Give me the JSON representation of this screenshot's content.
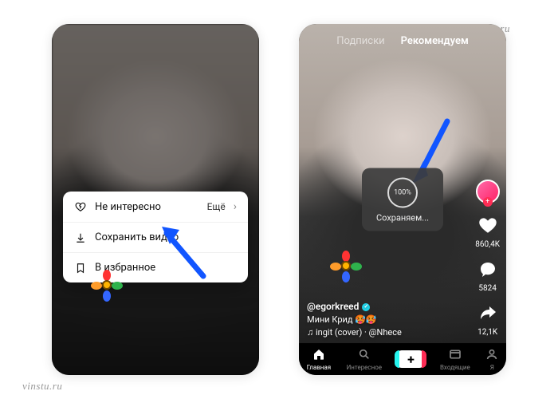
{
  "watermark": "vinstu.ru",
  "left": {
    "sheet": {
      "row1_label": "Не интересно",
      "row1_more": "Ещё",
      "row2_label": "Сохранить видео",
      "row3_label": "В избранное"
    }
  },
  "right": {
    "tabs": {
      "following": "Подписки",
      "foryou": "Рекомендуем"
    },
    "toast": {
      "percent": "100%",
      "label": "Сохраняем..."
    },
    "rail": {
      "likes": "860,4K",
      "comments": "5824",
      "shares": "12,1K"
    },
    "caption": {
      "user": "@egorkreed",
      "line1": "Мини Крид 🥵🥵",
      "line2": "♫  ingit (cover)  · @Nhece"
    },
    "nav": {
      "home": "Главная",
      "discover": "Интересное",
      "inbox": "Входящие",
      "me": "Я"
    }
  }
}
